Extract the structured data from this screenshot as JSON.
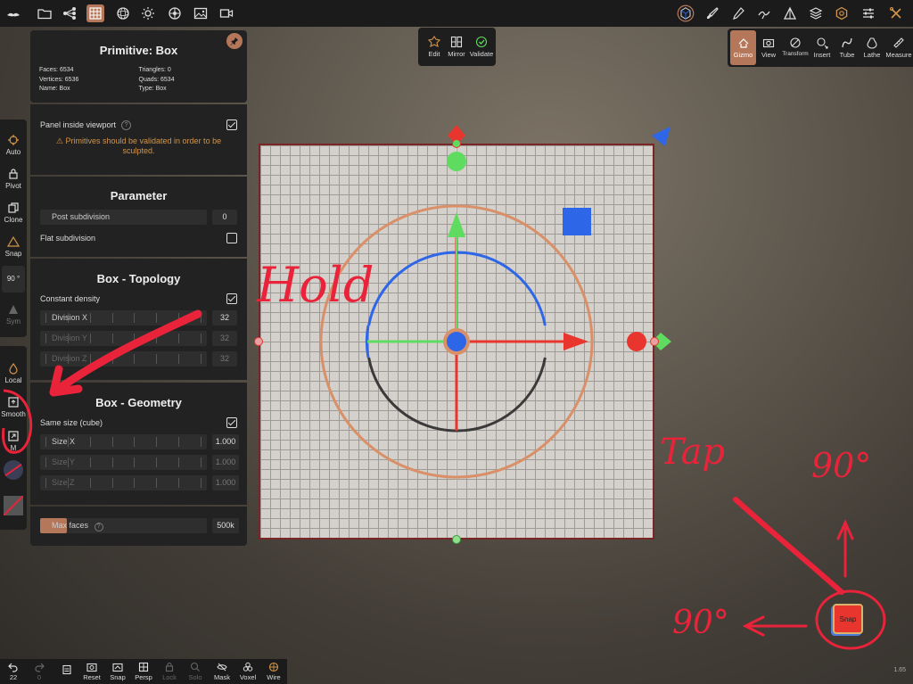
{
  "panel": {
    "title": "Primitive: Box",
    "info": {
      "faces": "Faces: 6534",
      "triangles": "Triangles: 0",
      "vertices": "Vertices: 6536",
      "quads": "Quads: 6534",
      "name": "Name: Box",
      "type": "Type: Box"
    },
    "panel_inside_viewport": "Panel inside viewport",
    "warning": "Primitives should be validated in order to be sculpted.",
    "parameter_title": "Parameter",
    "post_subdivision": {
      "label": "Post subdivision",
      "value": "0"
    },
    "flat_subdivision": "Flat subdivision",
    "topology_title": "Box - Topology",
    "constant_density": "Constant density",
    "division_x": {
      "label": "Division X",
      "value": "32"
    },
    "division_y": {
      "label": "Division Y",
      "value": "32"
    },
    "division_z": {
      "label": "Division Z",
      "value": "32"
    },
    "geometry_title": "Box - Geometry",
    "same_size": "Same size (cube)",
    "size_x": {
      "label": "Size X",
      "value": "1.000"
    },
    "size_y": {
      "label": "Size Y",
      "value": "1.000"
    },
    "size_z": {
      "label": "Size Z",
      "value": "1.000"
    },
    "max_faces": {
      "label": "Max faces",
      "value": "500k",
      "fill": 0.16
    }
  },
  "left_tools": {
    "auto": "Auto",
    "pivot": "Pivot",
    "clone": "Clone",
    "snap": "Snap",
    "angle": "90 °",
    "sym": "Sym",
    "local": "Local",
    "smooth": "Smooth",
    "m_partial": "M"
  },
  "primitive_toolbar": {
    "edit": "Edit",
    "mirror": "Mirror",
    "validate": "Validate"
  },
  "right_toolbar": {
    "gizmo": "Gizmo",
    "view": "View",
    "transform": "Transform",
    "insert": "Insert",
    "tube": "Tube",
    "lathe": "Lathe",
    "measure": "Measure"
  },
  "bottom_bar": {
    "undo_count": "22",
    "redo_count": "0",
    "reset": "Reset",
    "snap": "Snap",
    "persp": "Persp",
    "lock": "Lock",
    "solo": "Solo",
    "mask": "Mask",
    "voxel": "Voxel",
    "wire": "Wire"
  },
  "snap_button": "Snap",
  "annotations": {
    "hold": "Hold",
    "tap": "Tap",
    "deg_up": "90°",
    "deg_left": "90°"
  },
  "version": "1.65",
  "colors": {
    "accent": "#b57759",
    "warning": "#d2954a",
    "annotation": "#e8233a",
    "gizmo_x": "#e8362e",
    "gizmo_y": "#5fdc5f",
    "gizmo_z": "#2e66e8"
  }
}
